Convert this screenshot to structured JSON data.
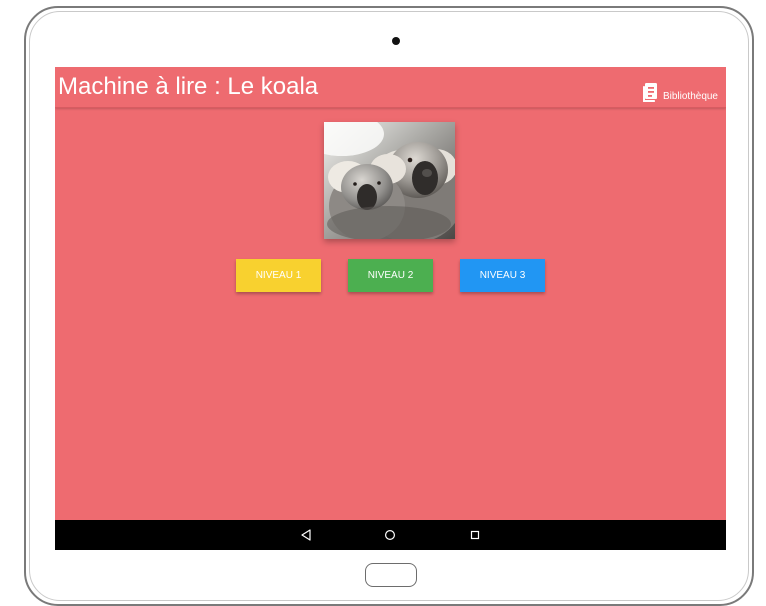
{
  "device": {
    "camera_icon": "front-camera",
    "home_button_icon": "hardware-home-button"
  },
  "app": {
    "title": "Machine à lire : Le koala",
    "library": {
      "label": "Bibliothèque",
      "icon": "library-book-icon"
    },
    "image": {
      "alt": "koala"
    },
    "levels": [
      {
        "label": "NIVEAU 1",
        "color": "#f8d12f"
      },
      {
        "label": "NIVEAU 2",
        "color": "#4caf50"
      },
      {
        "label": "NIVEAU 3",
        "color": "#2196f3"
      }
    ],
    "colors": {
      "background": "#ee6b70",
      "appbar": "#ee6b70",
      "navbar": "#000000"
    }
  },
  "system_nav": {
    "back_icon": "back-triangle-icon",
    "home_icon": "home-circle-icon",
    "recent_icon": "recent-square-icon"
  }
}
